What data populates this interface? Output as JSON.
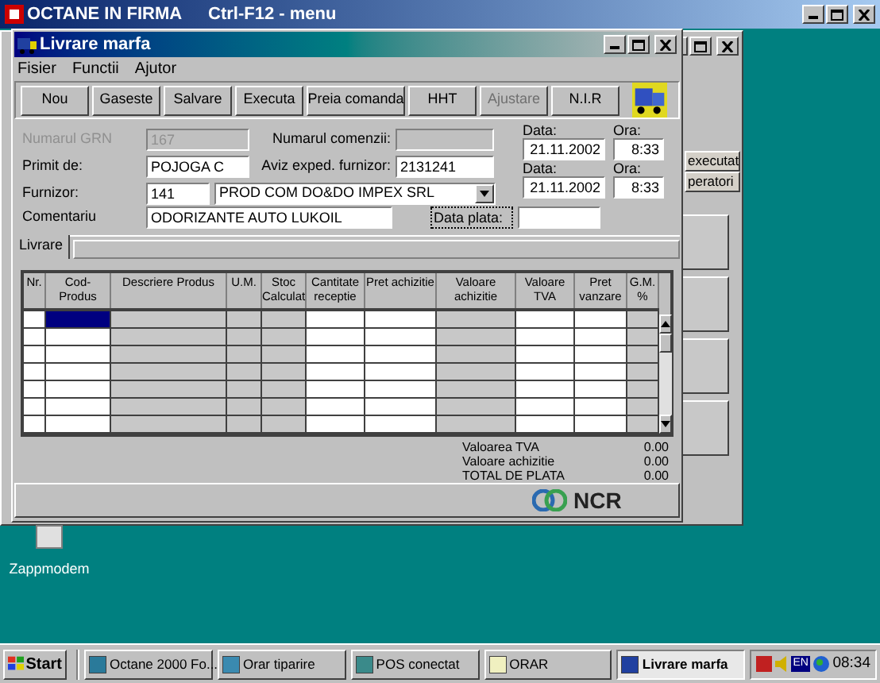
{
  "main_window": {
    "title": "OCTANE IN FIRMA",
    "hint": "Ctrl-F12 - menu"
  },
  "background_window": {
    "buttons": [
      "executat",
      "peratori"
    ]
  },
  "desktop_icons": [
    {
      "label": "Zappmodem"
    }
  ],
  "window": {
    "title": "Livrare marfa",
    "menu": [
      "Fisier",
      "Functii",
      "Ajutor"
    ],
    "toolbar": [
      {
        "label": "Nou",
        "disabled": false
      },
      {
        "label": "Gaseste",
        "disabled": false
      },
      {
        "label": "Salvare",
        "disabled": false
      },
      {
        "label": "Executa",
        "disabled": false
      },
      {
        "label": "Preia comanda",
        "disabled": false
      },
      {
        "label": "HHT",
        "disabled": false
      },
      {
        "label": "Ajustare",
        "disabled": true
      },
      {
        "label": "N.I.R",
        "disabled": false
      }
    ],
    "form": {
      "grn": {
        "label": "Numarul GRN",
        "value": "167",
        "disabled": true
      },
      "primit": {
        "label": "Primit de:",
        "value": "POJOGA C"
      },
      "furnizor": {
        "label": "Furnizor:",
        "code": "141",
        "name": "PROD COM DO&DO IMPEX SRL"
      },
      "comentariu": {
        "label": "Comentariu",
        "value": "ODORIZANTE AUTO LUKOIL"
      },
      "comenzii": {
        "label": "Numarul comenzii:"
      },
      "aviz": {
        "label": "Aviz exped. furnizor:",
        "value": "2131241"
      },
      "dates": [
        {
          "date_label": "Data:",
          "date": "21.11.2002",
          "time_label": "Ora:",
          "time": "8:33"
        },
        {
          "date_label": "Data:",
          "date": "21.11.2002",
          "time_label": "Ora:",
          "time": "8:33"
        }
      ],
      "data_plata": {
        "label": "Data plata:",
        "focused": true
      }
    },
    "tabs": [
      {
        "label": "Livrare",
        "selected": true
      }
    ],
    "grid": {
      "columns": [
        {
          "label": "Nr.",
          "editable": true
        },
        {
          "label": "Cod-Produs",
          "editable": true
        },
        {
          "label": "Descriere Produs",
          "editable": false
        },
        {
          "label": "U.M.",
          "editable": false
        },
        {
          "label": "Stoc Calculat",
          "editable": false
        },
        {
          "label": "Cantitate receptie",
          "editable": true
        },
        {
          "label": "Pret achizitie",
          "editable": true
        },
        {
          "label": "Valoare achizitie",
          "editable": false
        },
        {
          "label": "Valoare TVA",
          "editable": true
        },
        {
          "label": "Pret vanzare",
          "editable": true
        },
        {
          "label": "G.M. %",
          "editable": false
        }
      ],
      "rows": [
        {
          "selected": true
        },
        {
          "selected": false
        },
        {
          "selected": false
        },
        {
          "selected": false
        },
        {
          "selected": false
        },
        {
          "selected": false
        },
        {
          "selected": false
        }
      ]
    },
    "totals": [
      {
        "label": "Valoarea TVA",
        "value": "0.00"
      },
      {
        "label": "Valoare achizitie",
        "value": "0.00"
      },
      {
        "label": "TOTAL DE PLATA",
        "value": "0.00"
      }
    ],
    "brand": "NCR"
  },
  "taskbar": {
    "start": "Start",
    "items": [
      {
        "label": "Octane 2000 Fo...",
        "selected": false
      },
      {
        "label": "Orar tiparire",
        "selected": false
      },
      {
        "label": "POS conectat",
        "selected": false
      },
      {
        "label": "ORAR",
        "selected": false
      },
      {
        "label": "Livrare marfa",
        "selected": true
      }
    ],
    "tray_language": "EN",
    "clock": "08:34"
  }
}
